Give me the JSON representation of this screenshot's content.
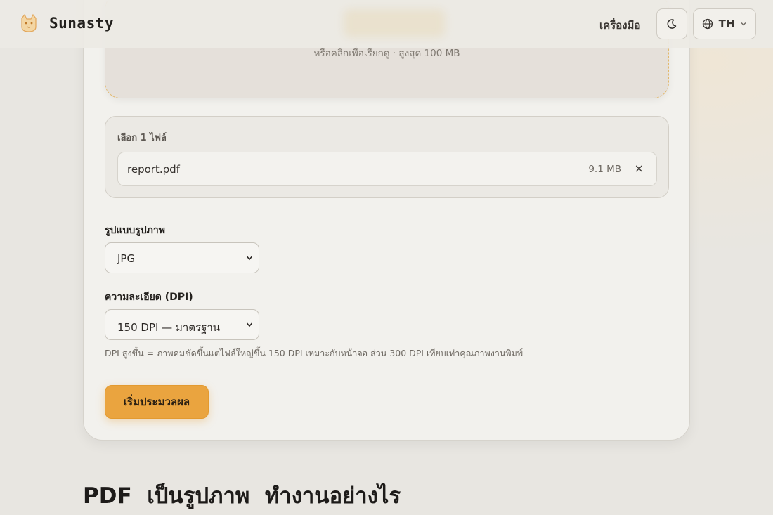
{
  "header": {
    "brand": "Sunasty",
    "tools_link": "เครื่องมือ",
    "lang_label": "TH"
  },
  "upload": {
    "hint": "หรือคลิกเพื่อเรียกดู · สูงสุด 100 MB",
    "selected_title": "เลือก 1 ไฟล์",
    "file": {
      "name": "report.pdf",
      "size": "9.1 MB",
      "remove_icon": "×"
    }
  },
  "options": {
    "format_label": "รูปแบบรูปภาพ",
    "format_value": "JPG",
    "dpi_label": "ความละเอียด (DPI)",
    "dpi_value": "150 DPI — มาตรฐาน",
    "dpi_help": "DPI สูงขึ้น = ภาพคมชัดขึ้นแต่ไฟล์ใหญ่ขึ้น 150 DPI เหมาะกับหน้าจอ ส่วน 300 DPI เทียบเท่าคุณภาพงานพิมพ์"
  },
  "actions": {
    "start": "เริ่มประมวลผล"
  },
  "section": {
    "title": "PDF  เป็นรูปภาพ  ทำงานอย่างไร"
  },
  "colors": {
    "accent": "#eaa43f",
    "dashed_border": "#e2b86c",
    "background": "#e8e6e1"
  },
  "icons": {
    "logo": "cat-logo-icon",
    "theme": "moon-icon",
    "language": "globe-icon",
    "dropdown": "chevron-down-icon"
  }
}
